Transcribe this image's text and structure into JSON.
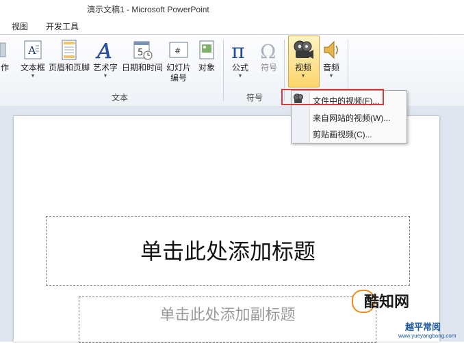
{
  "window": {
    "title": "演示文稿1  -  Microsoft PowerPoint"
  },
  "tabs": [
    {
      "label": "视图"
    },
    {
      "label": "开发工具"
    }
  ],
  "ribbon": {
    "partial_left_label": "作",
    "tools": [
      {
        "label": "文本框",
        "icon": "textbox-icon",
        "dropdown": true
      },
      {
        "label": "页眉和页脚",
        "icon": "header-footer-icon",
        "dropdown": false
      },
      {
        "label": "艺术字",
        "icon": "wordart-icon",
        "dropdown": true
      },
      {
        "label": "日期和时间",
        "icon": "date-time-icon",
        "dropdown": false
      },
      {
        "label": "幻灯片\n编号",
        "icon": "slide-number-icon",
        "dropdown": false
      },
      {
        "label": "对象",
        "icon": "object-icon",
        "dropdown": false
      },
      {
        "label": "公式",
        "icon": "equation-icon",
        "dropdown": true
      },
      {
        "label": "符号",
        "icon": "symbol-icon",
        "dropdown": false,
        "disabled": true
      },
      {
        "label": "视频",
        "icon": "video-icon",
        "dropdown": true,
        "active": true
      },
      {
        "label": "音频",
        "icon": "audio-icon",
        "dropdown": true
      }
    ],
    "groups": [
      {
        "label": "文本"
      },
      {
        "label": "符号"
      }
    ]
  },
  "video_menu": {
    "items": [
      {
        "label": "文件中的视频(F)...",
        "highlighted": true
      },
      {
        "label": "来自网站的视频(W)..."
      },
      {
        "label": "剪贴画视频(C)..."
      }
    ]
  },
  "slide": {
    "title_placeholder": "单击此处添加标题",
    "subtitle_placeholder": "单击此处添加副标题"
  },
  "watermark": {
    "logo": "酷知网",
    "text": "越平常阅",
    "url": "www.yueyangbang.com"
  }
}
